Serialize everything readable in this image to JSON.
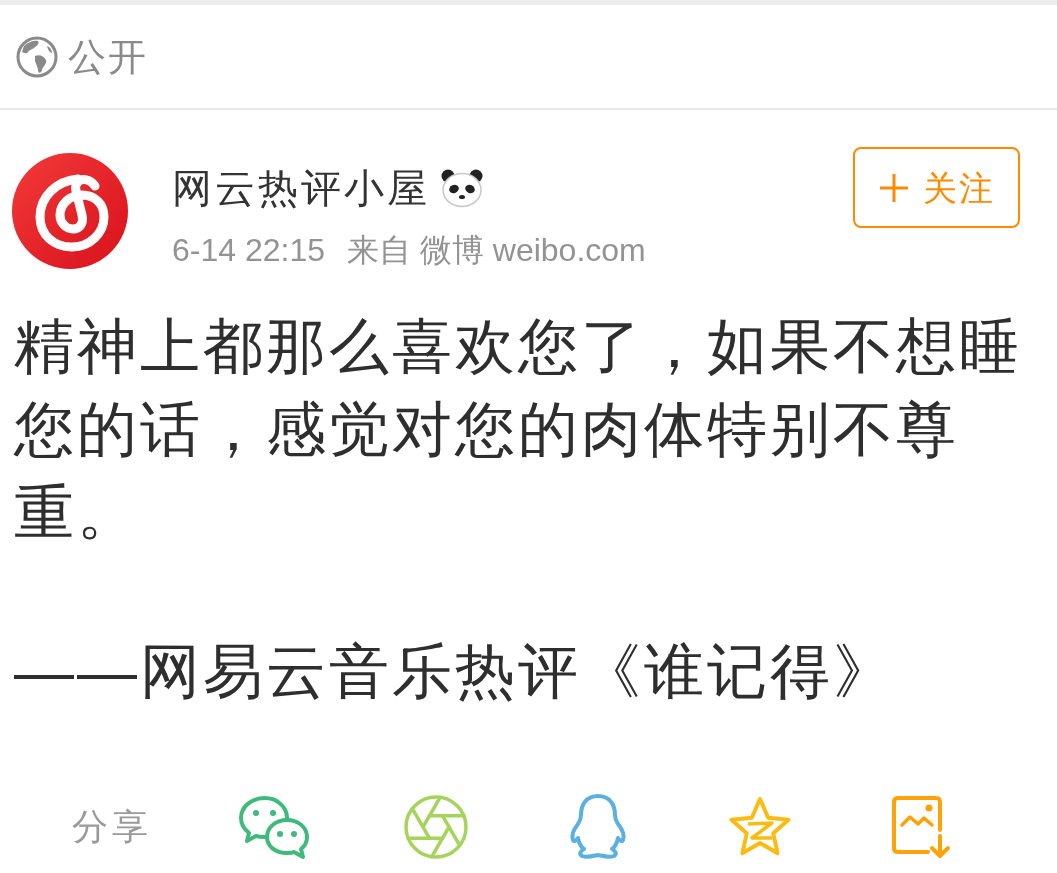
{
  "visibility": {
    "label": "公开"
  },
  "post": {
    "author": {
      "name": "网云热评小屋",
      "time": "6-14 22:15",
      "source": "来自 微博 weibo.com"
    },
    "follow_button": {
      "label": "关注"
    },
    "paragraphs": [
      "精神上都那么喜欢您了，如果不想睡您的话，感觉对您的肉体特别不尊重。",
      "——网易云音乐热评《谁记得》"
    ]
  },
  "share_bar": {
    "label": "分享"
  }
}
